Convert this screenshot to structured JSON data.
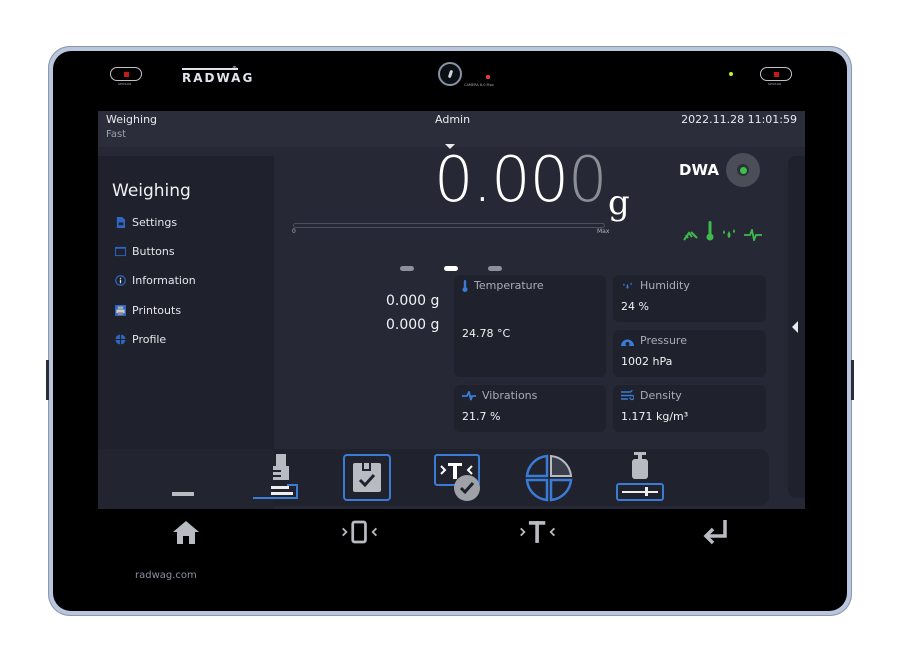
{
  "device": {
    "brand": "RADWAG",
    "registered_mark": "®",
    "sensor_left_label": "SENSOR",
    "sensor_right_label": "SENSOR",
    "camera_label": "CAMERA 8.0 Mpx",
    "website": "radwag.com"
  },
  "header": {
    "mode": "Weighing",
    "profile": "Fast",
    "user": "Admin",
    "datetime": "2022.11.28 11:01:59"
  },
  "sidebar": {
    "title": "Weighing",
    "items": [
      {
        "label": "Settings",
        "icon": "settings-doc-icon"
      },
      {
        "label": "Buttons",
        "icon": "buttons-icon"
      },
      {
        "label": "Information",
        "icon": "info-icon"
      },
      {
        "label": "Printouts",
        "icon": "printer-icon"
      },
      {
        "label": "Profile",
        "icon": "profile-icon"
      }
    ]
  },
  "display": {
    "weight_main": "0.00",
    "weight_last_digit": "0",
    "unit": "g",
    "range_min_label": "0",
    "range_max_label": "Max",
    "range_fill": 0,
    "dwa_label": "DWA",
    "extra_values": [
      "0.000 g",
      "0.000 g"
    ],
    "pager": {
      "pages": 3,
      "active": 2
    },
    "status_icons": [
      "leveling-icon",
      "thermometer-icon",
      "humidity-icon",
      "vibration-icon"
    ],
    "status_color": "#3dbb4a"
  },
  "environment": {
    "temperature": {
      "label": "Temperature",
      "value": "24.78 °C"
    },
    "humidity": {
      "label": "Humidity",
      "value": "24 %"
    },
    "pressure": {
      "label": "Pressure",
      "value": "1002 hPa"
    },
    "vibrations": {
      "label": "Vibrations",
      "value": "21.7 %"
    },
    "density": {
      "label": "Density",
      "value": "1.171 kg/m³"
    }
  },
  "toolbar": {
    "items": [
      "scale-base-icon",
      "print-header-icon",
      "save-check-icon",
      "tare-check-icon",
      "pie-chart-icon",
      "calibration-weight-icon"
    ]
  },
  "bottom_bar": {
    "items": [
      "home-icon",
      "zero-icon",
      "tare-icon",
      "enter-icon"
    ]
  },
  "colors": {
    "accent_blue": "#3a7bd5",
    "status_green": "#3dbb4a",
    "screen_bg": "#262935"
  }
}
